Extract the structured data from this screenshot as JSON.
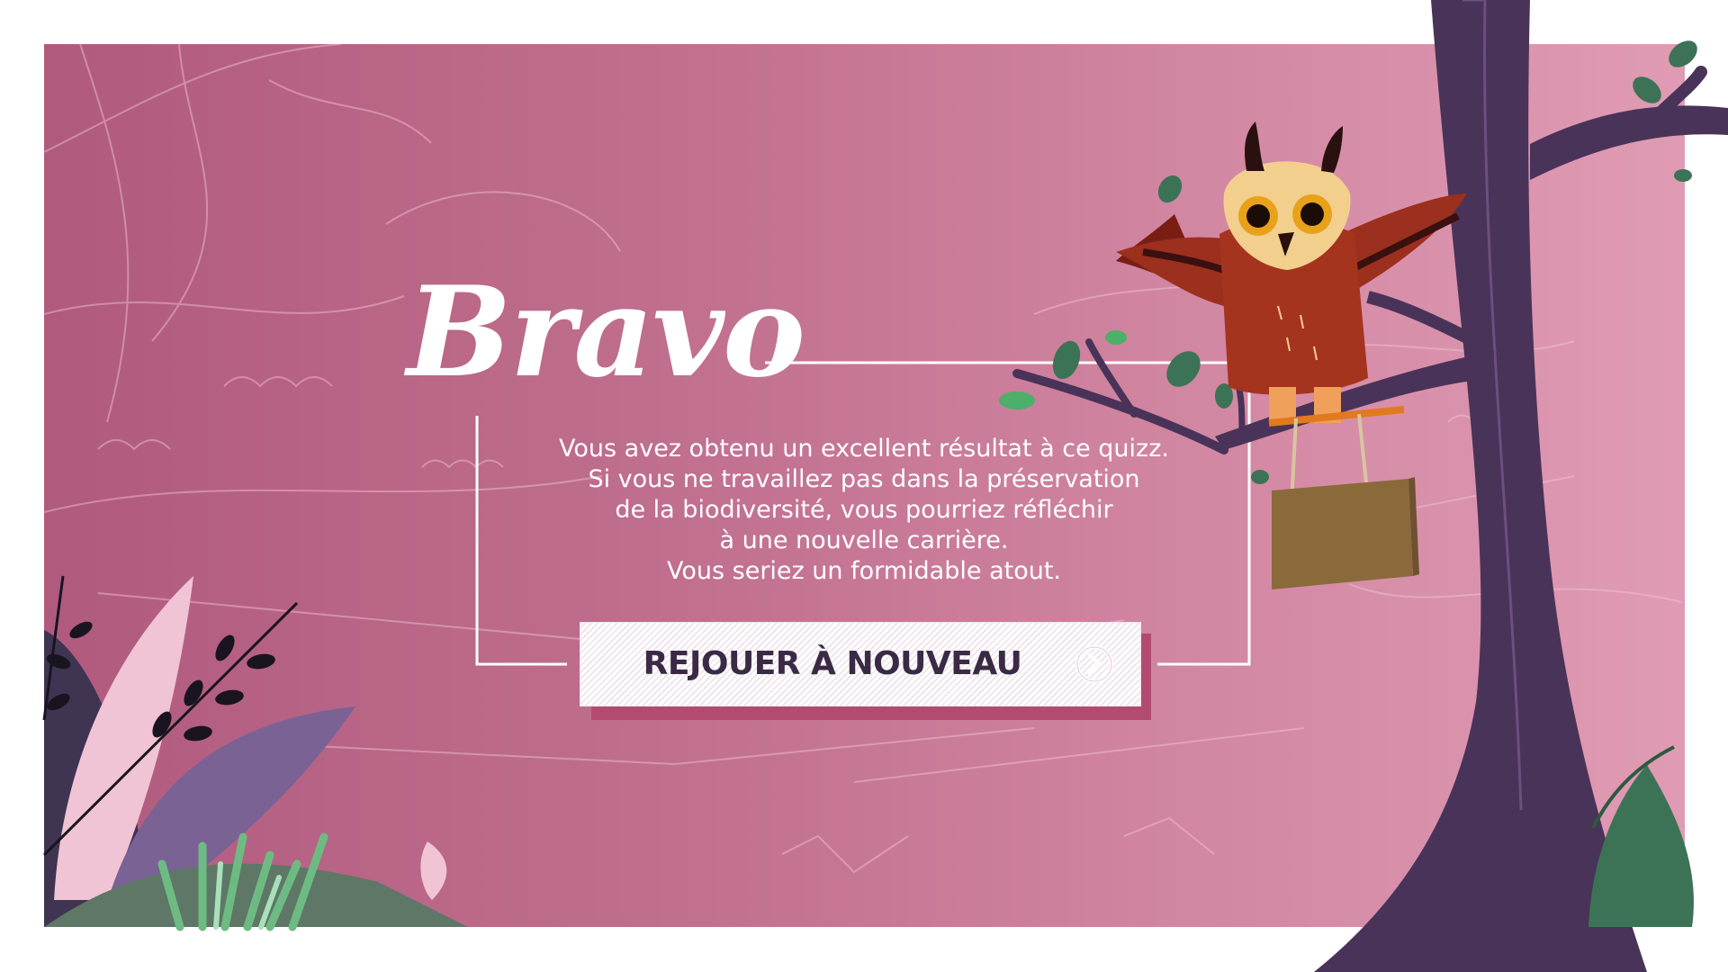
{
  "result": {
    "title": "Bravo",
    "message_lines": [
      "Vous avez obtenu un excellent résultat à ce quizz.",
      "Si vous ne travaillez pas dans la préservation",
      "de la biodiversité, vous pourriez réfléchir",
      "à une nouvelle carrière.",
      "Vous seriez un formidable atout."
    ]
  },
  "replay_button": {
    "label": "REJOUER À NOUVEAU",
    "icon": "arrow-circle-right-icon"
  },
  "colors": {
    "panel_left": "#b05a7e",
    "panel_right": "#e09bb4",
    "button_text": "#3a2a45",
    "button_shadow": "#b34a72",
    "tree": "#4a3358"
  }
}
